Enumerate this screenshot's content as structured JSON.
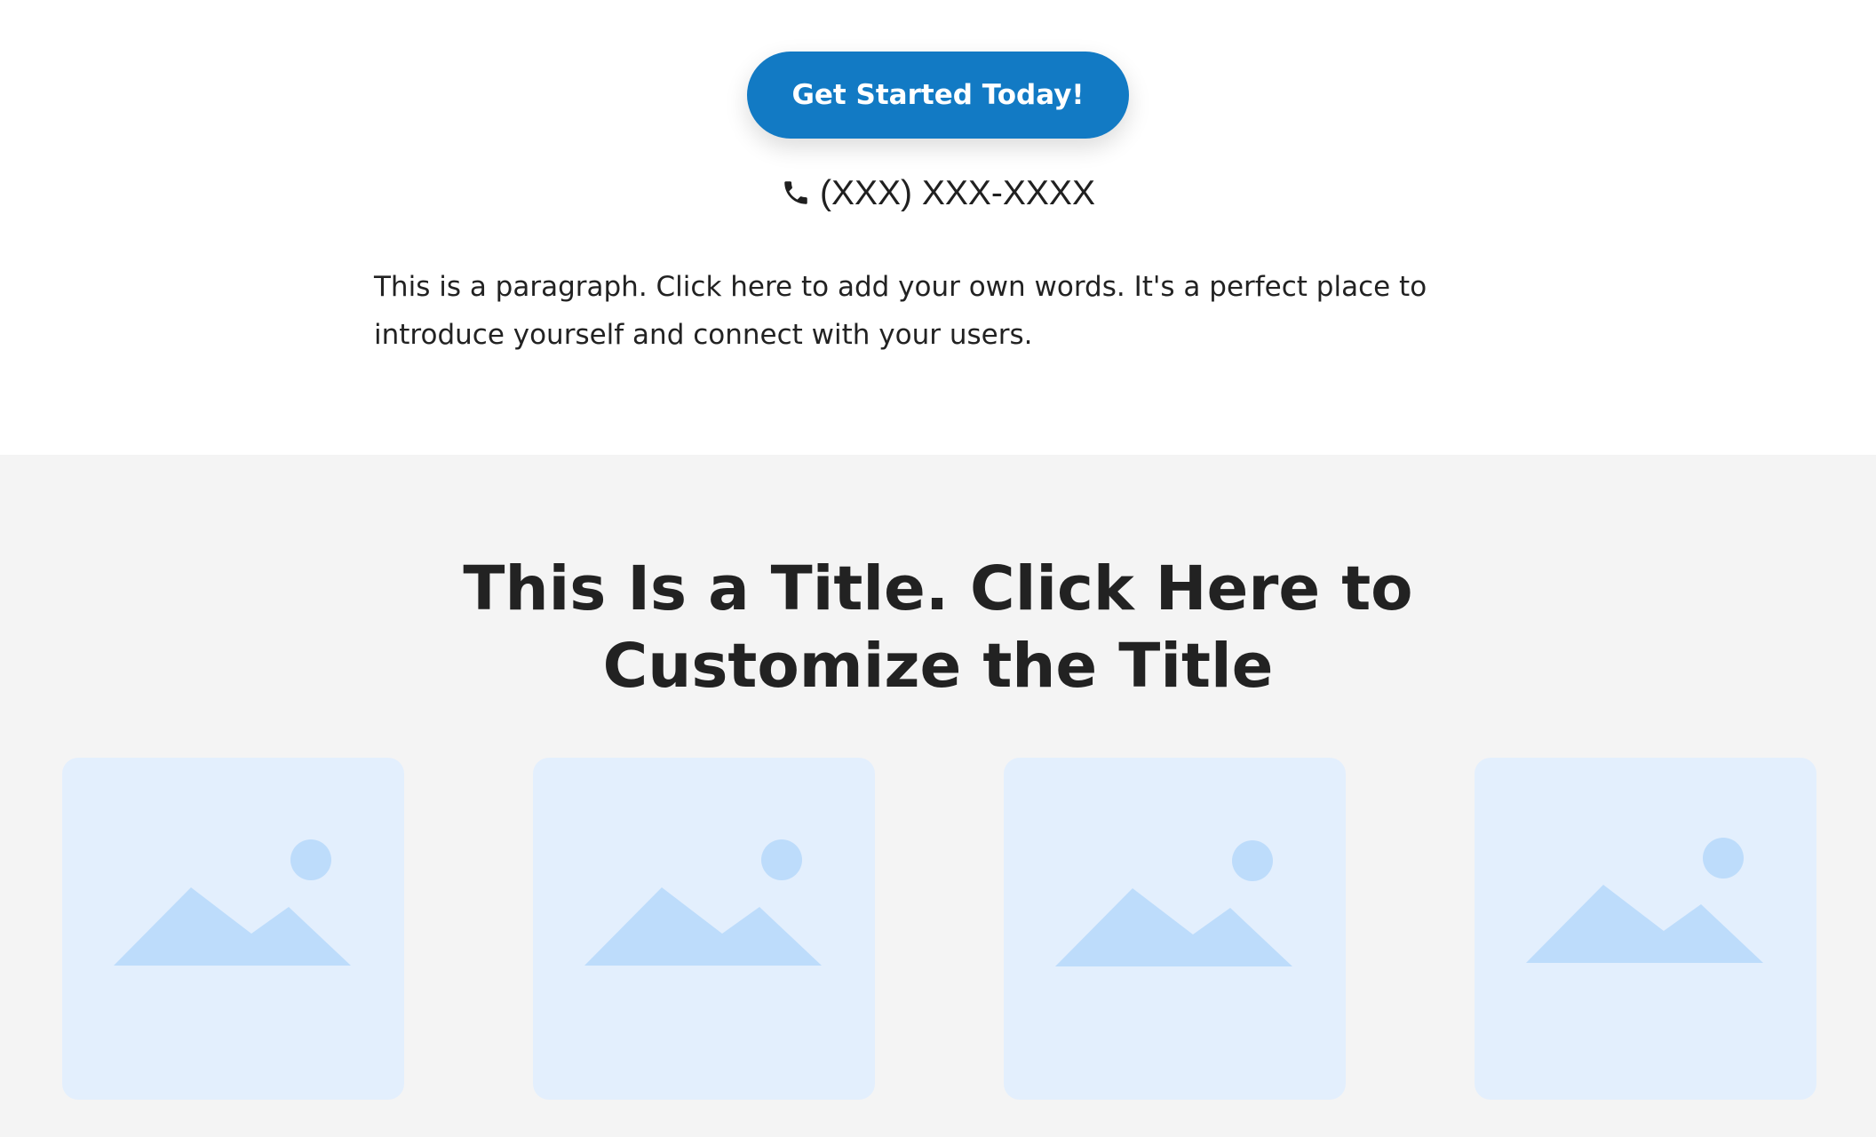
{
  "hero": {
    "cta_label": "Get Started Today!",
    "phone_text": "(XXX) XXX-XXXX",
    "phone_icon": "phone-icon",
    "paragraph": "This is a paragraph. Click here to add your own words. It's a perfect place to introduce yourself and connect with your users."
  },
  "gallery": {
    "title_line_1": "This Is a Title. Click Here to",
    "title_line_2": "Customize the Title",
    "placeholder_icon": "image-placeholder-icon",
    "items": [
      {
        "alt": "image placeholder 1"
      },
      {
        "alt": "image placeholder 2"
      },
      {
        "alt": "image placeholder 3"
      },
      {
        "alt": "image placeholder 4"
      }
    ]
  },
  "colors": {
    "accent": "#127ac4",
    "section_background": "#f4f4f4",
    "placeholder_background": "#e3effd",
    "placeholder_shape": "#bddcfb",
    "text": "#222222"
  }
}
